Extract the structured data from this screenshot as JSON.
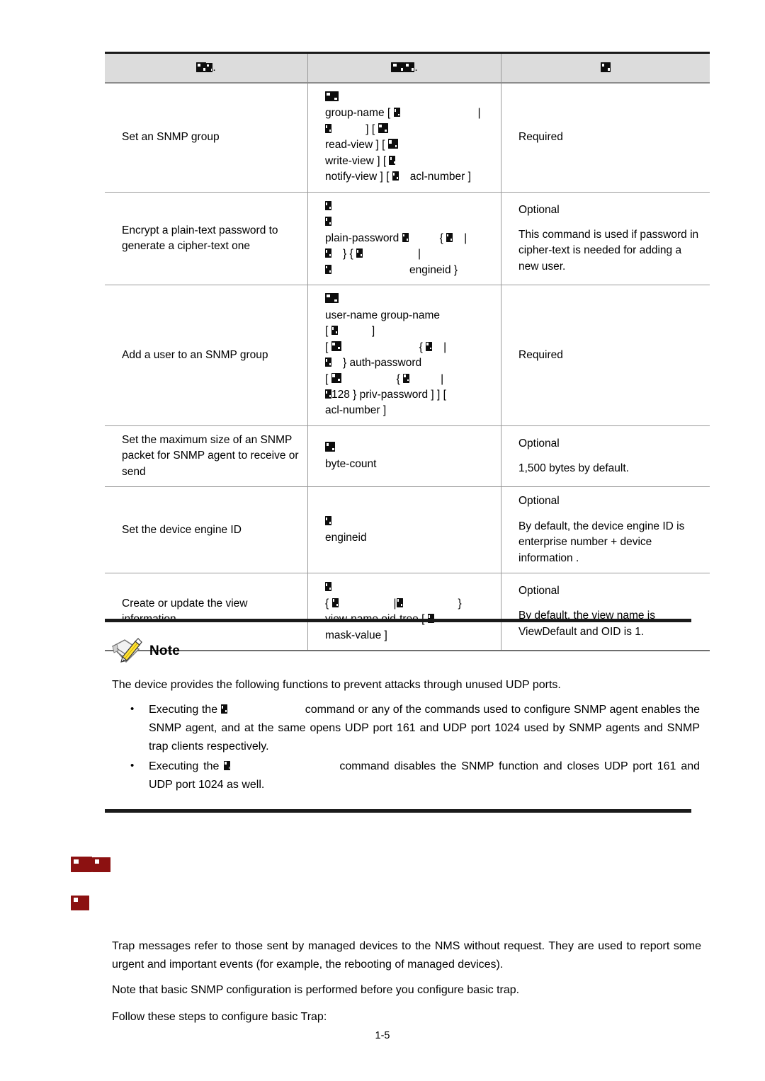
{
  "document": {
    "page_number": "1-5",
    "heading_color": "#8c1111",
    "table_header_bg": "#dcdcdc"
  },
  "table": {
    "headers": {
      "operation": "Operation",
      "command": "Command",
      "remarks": "Remarks"
    },
    "rows": [
      {
        "operation": "Set an SNMP group",
        "command_lines": [
          "group-name [ ",
          " ] [ ",
          "read-view ] [ ",
          "write-view ] [ ",
          "notify-view ] [ ",
          "acl-number ]"
        ],
        "remarks": [
          "Required"
        ]
      },
      {
        "operation": "Encrypt a plain-text password to generate a cipher-text one",
        "command_lines": [
          "plain-password",
          "{",
          "} {",
          "engineid }"
        ],
        "remarks": [
          "Optional",
          "This command is used if password in cipher-text is needed for adding a new user."
        ]
      },
      {
        "operation": "Add a user to an SNMP group",
        "command_lines": [
          "user-name group-name",
          "[ ",
          " ]",
          "[ ",
          "{ ",
          "} auth-password",
          "[ ",
          "{ ",
          "128 } priv-password ] ] [ ",
          "acl-number ]"
        ],
        "remarks": [
          "Required"
        ]
      },
      {
        "operation": "Set the maximum size of an SNMP packet for SNMP agent to receive or send",
        "command_lines": [
          "byte-count"
        ],
        "remarks": [
          "Optional",
          "1,500 bytes by default."
        ]
      },
      {
        "operation": "Set the device engine ID",
        "command_lines": [
          "engineid"
        ],
        "remarks": [
          "Optional",
          "By default, the device engine ID is  enterprise number + device information ."
        ]
      },
      {
        "operation": "Create or update the view information",
        "command_lines": [
          "{",
          "|",
          "}",
          "view-name oid-tree [ ",
          "mask-value ]"
        ],
        "remarks": [
          "Optional",
          "By default, the view name is  ViewDefault  and OID is 1."
        ]
      }
    ]
  },
  "note": {
    "icon": "note-pencil-icon",
    "label": "Note",
    "intro": "The device provides the following functions to prevent attacks through unused UDP ports.",
    "bullets": [
      {
        "marker": "•",
        "text_before": "Executing the",
        "text_after": "command or any of the commands used to configure SNMP agent enables the SNMP agent, and at the same opens UDP port 161 and UDP port 1024 used by SNMP agents and SNMP trap clients respectively."
      },
      {
        "marker": "•",
        "text_before": "Executing the",
        "text_after": "command disables the SNMP function and closes UDP port 161 and UDP port 1024 as well."
      }
    ]
  },
  "body": {
    "paragraph_1": "Trap messages refer to those sent by managed devices to the NMS without request. They are used to report some urgent and important events (for example, the rebooting of managed devices).",
    "paragraph_2": "Note that basic SNMP configuration is performed before you configure basic trap.",
    "paragraph_3": "Follow these steps to configure basic Trap:"
  }
}
